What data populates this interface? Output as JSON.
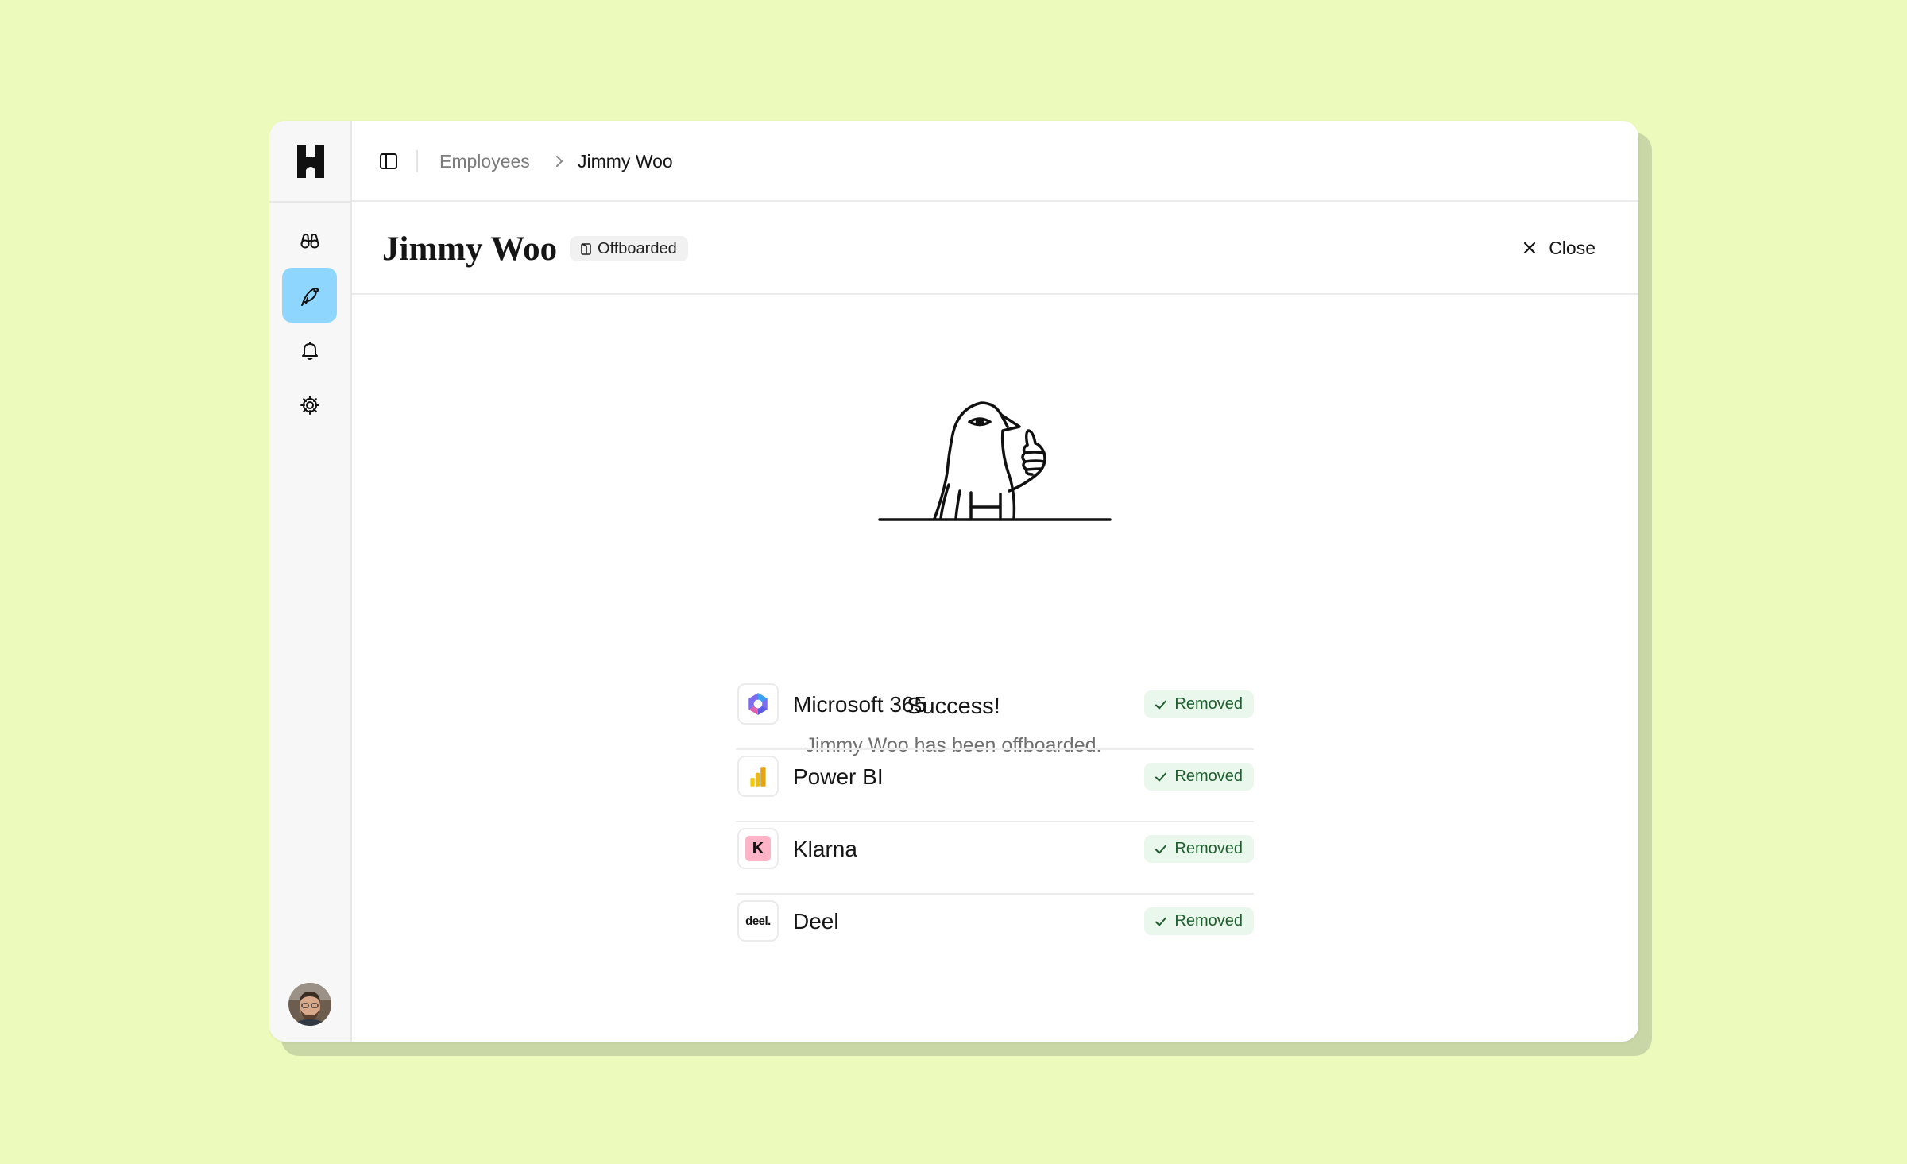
{
  "breadcrumb": {
    "parent": "Employees",
    "current": "Jimmy Woo"
  },
  "header": {
    "title": "Jimmy Woo",
    "status": "Offboarded",
    "close_label": "Close"
  },
  "nav": [
    {
      "icon": "binoculars-icon",
      "active": false
    },
    {
      "icon": "bird-icon",
      "active": true
    },
    {
      "icon": "bell-icon",
      "active": false
    },
    {
      "icon": "gear-icon",
      "active": false
    }
  ],
  "success": {
    "title": "Success!",
    "message": "Jimmy Woo has been offboarded."
  },
  "apps": [
    {
      "name": "Microsoft 365",
      "icon": "microsoft-365-icon",
      "status": "Removed"
    },
    {
      "name": "Power BI",
      "icon": "power-bi-icon",
      "status": "Removed"
    },
    {
      "name": "Klarna",
      "icon": "klarna-icon",
      "icon_text": "K",
      "status": "Removed"
    },
    {
      "name": "Deel",
      "icon": "deel-icon",
      "icon_text": "deel.",
      "status": "Removed"
    }
  ],
  "colors": {
    "background": "#ecfbbb",
    "nav_active": "#8fd6ff",
    "removed_badge": "#eaf7ec",
    "klarna_pink": "#ffb3c7"
  }
}
